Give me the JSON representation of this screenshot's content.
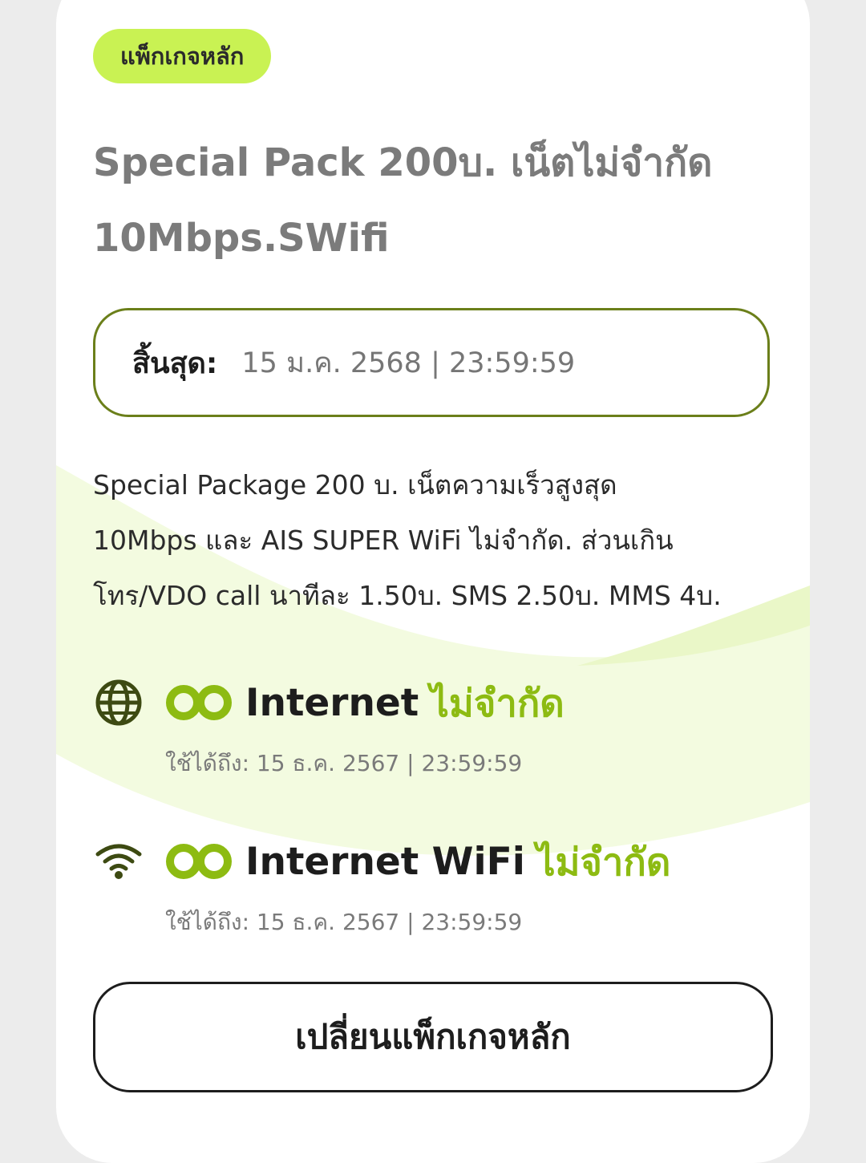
{
  "package": {
    "badge": "แพ็กเกจหลัก",
    "title_line1": "Special Pack 200บ. เน็ตไม่จำกัด",
    "title_line2": "10Mbps.SWifi",
    "expiry_label": "สิ้นสุด:",
    "expiry_value": "15 ม.ค. 2568 | 23:59:59",
    "description_lines": [
      "Special Package 200 บ. เน็ตความเร็วสูงสุด",
      "10Mbps และ AIS SUPER WiFi ไม่จำกัด. ส่วนเกิน",
      "โทร/VDO call นาทีละ 1.50บ. SMS 2.50บ. MMS 4บ."
    ]
  },
  "features": [
    {
      "icon": "globe-icon",
      "name": "Internet",
      "unlimited": "ไม่จำกัด",
      "valid_until": "ใช้ได้ถึง: 15 ธ.ค. 2567 | 23:59:59"
    },
    {
      "icon": "wifi-icon",
      "name": "Internet WiFi",
      "unlimited": "ไม่จำกัด",
      "valid_until": "ใช้ได้ถึง: 15 ธ.ค. 2567 | 23:59:59"
    }
  ],
  "actions": {
    "change_package_label": "เปลี่ยนแพ็กเกจหลัก"
  },
  "colors": {
    "accent_green": "#8dbb12",
    "badge_bg": "#c9f253",
    "border_olive": "#6b7f1a"
  }
}
